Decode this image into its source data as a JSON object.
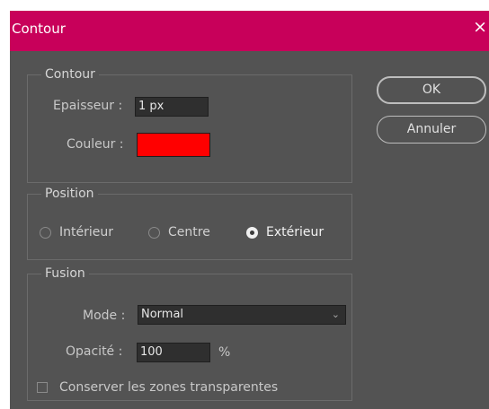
{
  "window": {
    "title": "Contour",
    "close_glyph": "×"
  },
  "contour": {
    "legend": "Contour",
    "thickness_label": "Epaisseur :",
    "thickness_value": "1 px",
    "color_label": "Couleur :",
    "color_value": "#ff0000"
  },
  "position": {
    "legend": "Position",
    "options": [
      {
        "label": "Intérieur",
        "selected": false
      },
      {
        "label": "Centre",
        "selected": false
      },
      {
        "label": "Extérieur",
        "selected": true
      }
    ]
  },
  "fusion": {
    "legend": "Fusion",
    "mode_label": "Mode :",
    "mode_value": "Normal",
    "opacity_label": "Opacité :",
    "opacity_value": "100",
    "opacity_unit": "%",
    "preserve_label": "Conserver les zones transparentes",
    "preserve_checked": false
  },
  "buttons": {
    "ok": "OK",
    "cancel": "Annuler"
  },
  "colors": {
    "title_bar": "#c8005a",
    "panel": "#535353",
    "field": "#2f2f2f"
  }
}
